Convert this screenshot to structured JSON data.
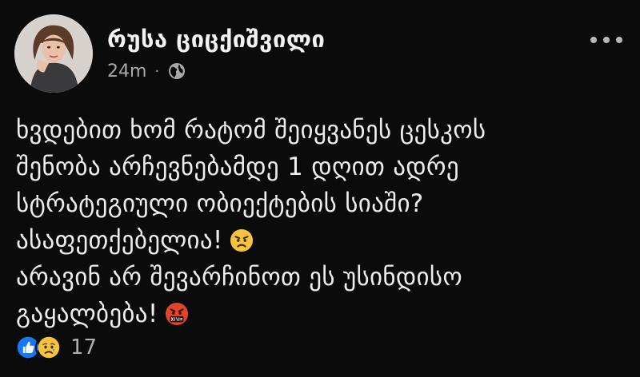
{
  "post": {
    "author_name": "რუსა ციცქიშვილი",
    "timestamp": "24m",
    "separator": "·",
    "audience_icon": "globe-icon",
    "more_icon": "more-horizontal-icon",
    "body_lines": [
      "ხვდებით ხომ რატომ შეიყვანეს ცესკოს",
      "შენობა არჩევნებამდე 1 დღით ადრე",
      "სტრატეგიული ობიექტების სიაში?",
      "ასაფეთქებელია!",
      "არავინ არ შევარჩინოთ ეს უსინდისო",
      "გაყალბება!"
    ],
    "inline_emojis": [
      "angry-face-emoji",
      "face-with-symbols-on-mouth-emoji"
    ],
    "reactions": {
      "icons": [
        "like-icon",
        "sad-icon"
      ],
      "count": "17"
    }
  },
  "colors": {
    "background": "#0b0b0c",
    "text": "#ededed",
    "secondary_text": "#a8a8a8",
    "like_blue": "#1877f2",
    "emoji_yellow": "#f7c33c",
    "angry_red": "#e0452b"
  }
}
